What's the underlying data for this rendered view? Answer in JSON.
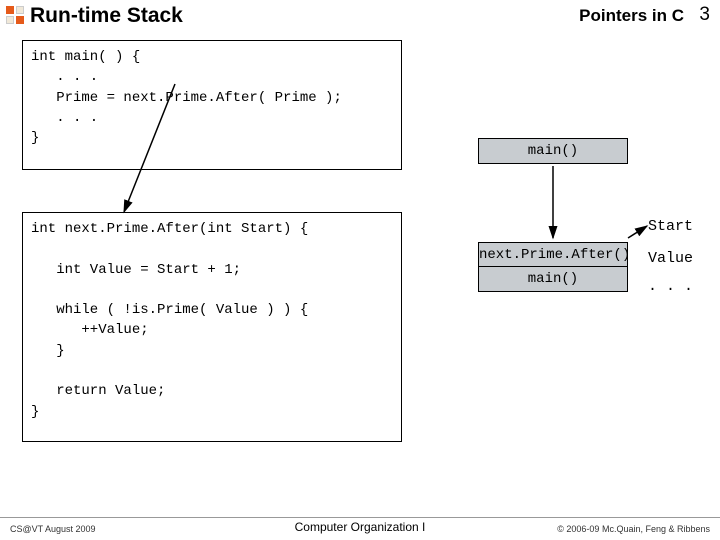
{
  "header": {
    "title": "Run-time Stack",
    "subtitle": "Pointers in C",
    "pagenum": "3"
  },
  "code1": "int main( ) {\n   . . .\n   Prime = next.Prime.After( Prime );\n   . . .\n}",
  "code2": "int next.Prime.After(int Start) {\n\n   int Value = Start + 1;\n\n   while ( !is.Prime( Value ) ) {\n      ++Value;\n   }\n\n   return Value;\n}",
  "stack": {
    "box1": "main()",
    "box2": "next.Prime.After()",
    "box3": "main()"
  },
  "labels": {
    "start": "Start",
    "value": "Value",
    "dots": ". . ."
  },
  "footer": {
    "left": "CS@VT August 2009",
    "center": "Computer Organization I",
    "right": "© 2006-09  Mc.Quain, Feng & Ribbens"
  }
}
